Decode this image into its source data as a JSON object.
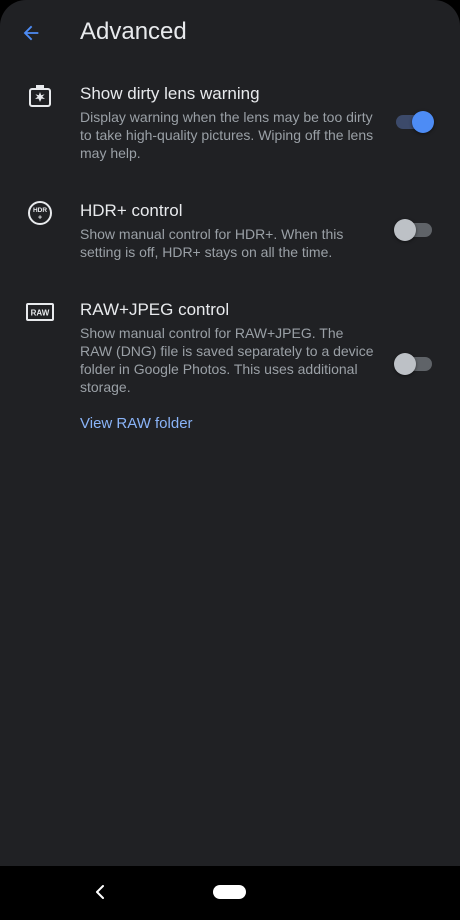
{
  "header": {
    "title": "Advanced",
    "back_icon": "arrow-back-icon",
    "accent_color": "#4d8cf5"
  },
  "settings": [
    {
      "icon": "dirty-lens-icon",
      "title": "Show dirty lens warning",
      "description": "Display warning when the lens may be too dirty to take high-quality pictures. Wiping off the lens may help.",
      "enabled": true
    },
    {
      "icon": "hdr-plus-icon",
      "title": "HDR+ control",
      "description": "Show manual control for HDR+. When this setting is off, HDR+ stays on all the time.",
      "enabled": false
    },
    {
      "icon": "raw-icon",
      "title": "RAW+JPEG control",
      "description": "Show manual control for RAW+JPEG. The RAW (DNG) file is saved separately to a device folder in Google Photos. This uses additional storage.",
      "enabled": false,
      "link_label": "View RAW folder"
    }
  ],
  "nav_bar": {
    "back_icon": "nav-back-icon",
    "home_icon": "home-pill-icon"
  }
}
